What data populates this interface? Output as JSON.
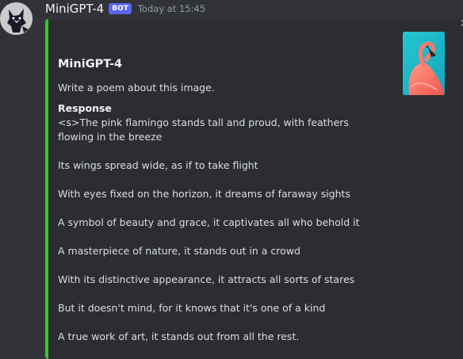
{
  "message": {
    "username": "MiniGPT-4",
    "badge": "BOT",
    "timestamp": "Today at 15:45"
  },
  "embed": {
    "accent_color": "#2ecc27",
    "title": "MiniGPT-4",
    "description": "Write a poem about this image.",
    "field_name": "Response",
    "lines": [
      "<s>The pink flamingo stands tall and proud, with feathers flowing in the breeze",
      "Its wings spread wide, as if to take flight",
      "With eyes fixed on the horizon, it dreams of faraway sights",
      "A symbol of beauty and grace, it captivates all who behold it",
      "A masterpiece of nature, it stands out in a crowd",
      "With its distinctive appearance, it attracts all sorts of stares",
      "But it doesn't mind, for it knows that it's one of a kind",
      "A true work of art, it stands out from all the rest."
    ]
  },
  "icons": {
    "avatar": "fox-avatar-icon",
    "thumbnail": "flamingo-thumbnail",
    "close": "close-icon"
  },
  "colors": {
    "background": "#313338",
    "embed_background": "#2b2d31",
    "badge": "#5865f2"
  }
}
